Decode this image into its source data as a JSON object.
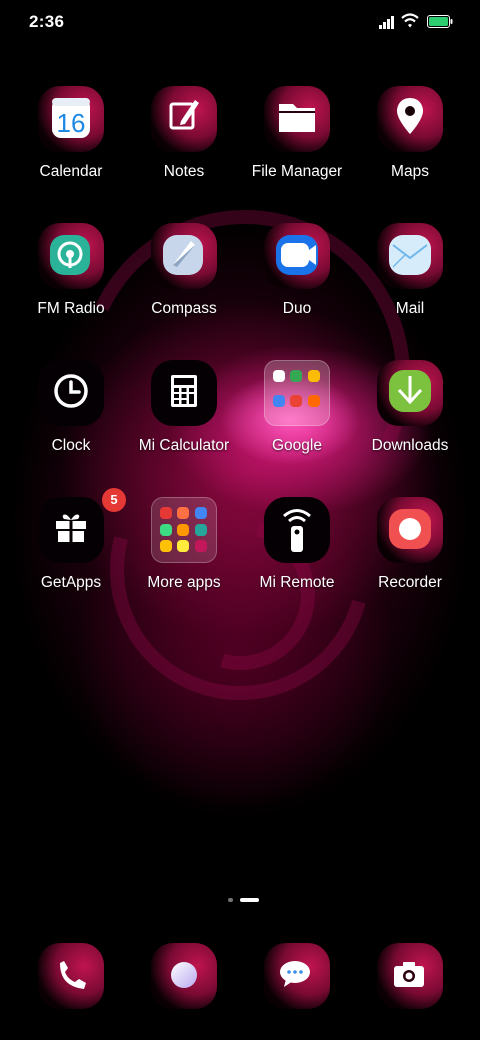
{
  "status": {
    "time": "2:36"
  },
  "apps": [
    {
      "label": "Calendar",
      "icon": "calendar-icon",
      "day": "16"
    },
    {
      "label": "Notes",
      "icon": "notes-icon"
    },
    {
      "label": "File Manager",
      "icon": "folder-icon"
    },
    {
      "label": "Maps",
      "icon": "map-pin-icon"
    },
    {
      "label": "FM Radio",
      "icon": "radio-icon"
    },
    {
      "label": "Compass",
      "icon": "compass-icon"
    },
    {
      "label": "Duo",
      "icon": "video-icon"
    },
    {
      "label": "Mail",
      "icon": "mail-icon"
    },
    {
      "label": "Clock",
      "icon": "clock-icon"
    },
    {
      "label": "Mi Calculator",
      "icon": "calculator-icon"
    },
    {
      "label": "Google",
      "icon": "folder-google"
    },
    {
      "label": "Downloads",
      "icon": "download-icon"
    },
    {
      "label": "GetApps",
      "icon": "gift-icon",
      "badge": "5"
    },
    {
      "label": "More apps",
      "icon": "folder-more-apps"
    },
    {
      "label": "Mi Remote",
      "icon": "remote-icon"
    },
    {
      "label": "Recorder",
      "icon": "recorder-icon"
    }
  ],
  "dock": [
    {
      "icon": "phone-icon"
    },
    {
      "icon": "browser-icon"
    },
    {
      "icon": "messages-icon"
    },
    {
      "icon": "camera-icon"
    }
  ],
  "pages": {
    "count": 2,
    "current": 2
  },
  "colors": {
    "badge": "#e53935",
    "accent": "#c0144f"
  }
}
